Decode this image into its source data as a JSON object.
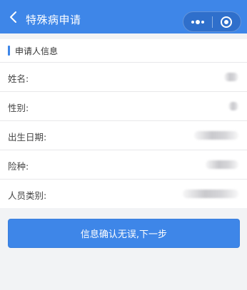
{
  "header": {
    "title": "特殊病申请",
    "back_icon": "chevron-left-icon",
    "more_icon": "more-dots-icon",
    "close_icon": "target-circle-icon",
    "bg_color": "#3e86e8"
  },
  "section": {
    "title": "申请人信息",
    "accent_color": "#3e86e8"
  },
  "fields": [
    {
      "label": "姓名:",
      "value": ""
    },
    {
      "label": "性别:",
      "value": ""
    },
    {
      "label": "出生日期:",
      "value": ""
    },
    {
      "label": "险种:",
      "value": ""
    },
    {
      "label": "人员类别:",
      "value": ""
    }
  ],
  "actions": {
    "next_label": "信息确认无误,下一步"
  }
}
